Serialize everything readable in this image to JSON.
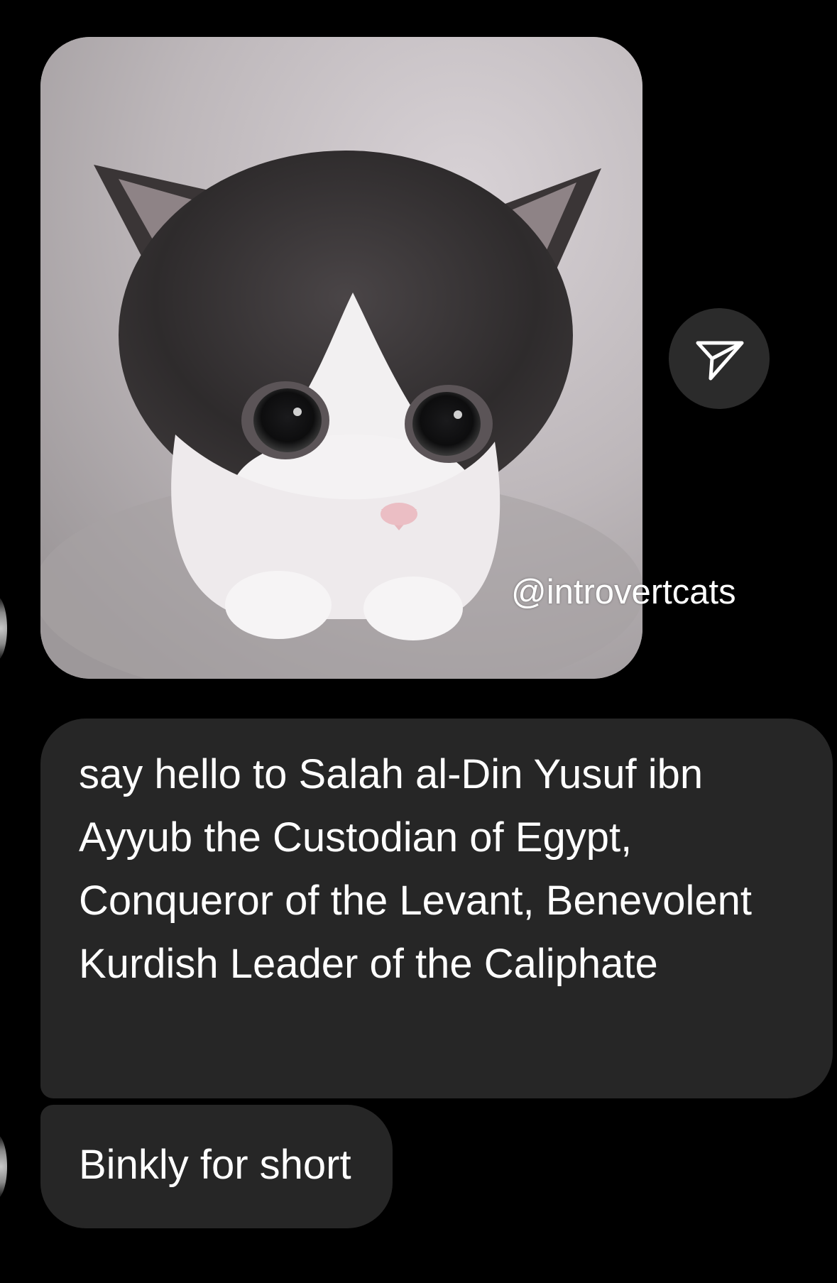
{
  "conversation": {
    "media_message": {
      "image_subject": "black and white kitten",
      "watermark": "@introvertcats"
    },
    "share_icon": "paper-plane-icon",
    "messages": [
      {
        "text": "say hello to Salah al-Din Yusuf ibn Ayyub the Custodian of Egypt, Conqueror of the Levant, Benevolent Kurdish Leader of the Caliphate"
      },
      {
        "text": "Binkly for short"
      }
    ]
  },
  "colors": {
    "background": "#000000",
    "bubble": "#262626",
    "text": "#ffffff",
    "share_button": "#2b2b2b"
  }
}
